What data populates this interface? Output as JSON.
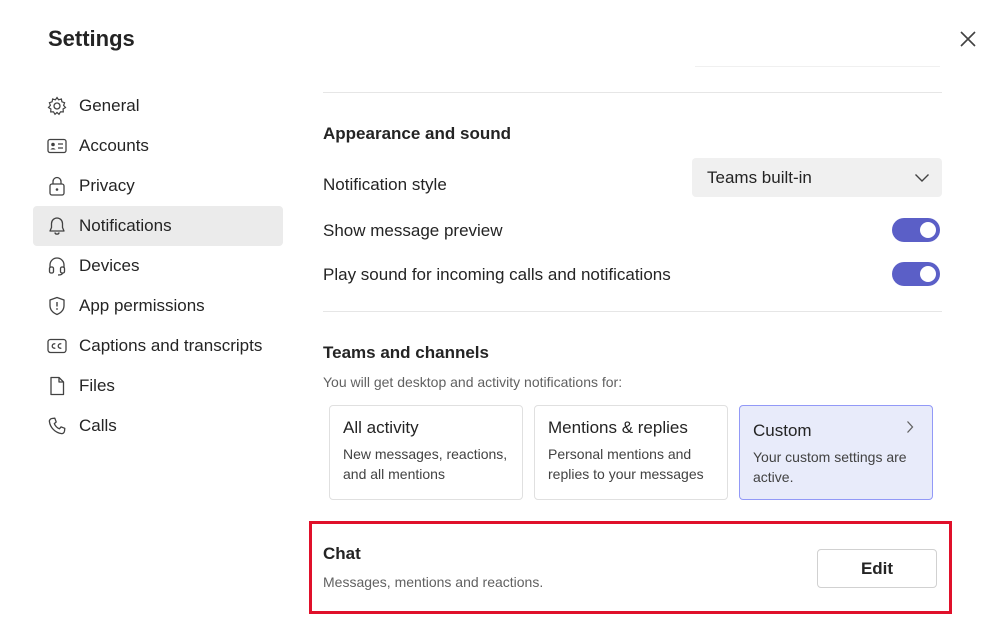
{
  "dialog": {
    "title": "Settings"
  },
  "nav": {
    "items": [
      {
        "label": "General",
        "icon": "gear-icon"
      },
      {
        "label": "Accounts",
        "icon": "id-card-icon"
      },
      {
        "label": "Privacy",
        "icon": "lock-icon"
      },
      {
        "label": "Notifications",
        "icon": "bell-icon",
        "active": true
      },
      {
        "label": "Devices",
        "icon": "headset-icon"
      },
      {
        "label": "App permissions",
        "icon": "shield-icon"
      },
      {
        "label": "Captions and transcripts",
        "icon": "closed-captions-icon"
      },
      {
        "label": "Files",
        "icon": "file-icon"
      },
      {
        "label": "Calls",
        "icon": "phone-icon"
      }
    ]
  },
  "appearance": {
    "title": "Appearance and sound",
    "notification_style_label": "Notification style",
    "notification_style_value": "Teams built-in",
    "show_preview_label": "Show message preview",
    "show_preview_on": true,
    "play_sound_label": "Play sound for incoming calls and notifications",
    "play_sound_on": true
  },
  "teams_channels": {
    "title": "Teams and channels",
    "subtitle": "You will get desktop and activity notifications for:",
    "options": [
      {
        "title": "All activity",
        "desc": "New messages, reactions, and all mentions"
      },
      {
        "title": "Mentions & replies",
        "desc": "Personal mentions and replies to your messages"
      },
      {
        "title": "Custom",
        "desc": "Your custom settings are active.",
        "selected": true
      }
    ]
  },
  "chat": {
    "title": "Chat",
    "subtitle": "Messages, mentions and reactions.",
    "edit_label": "Edit"
  },
  "colors": {
    "accent": "#5b5fc7",
    "selected_card_bg": "#e8ebfa",
    "highlight_border": "#e0102a",
    "nav_active_bg": "#ebebeb"
  }
}
